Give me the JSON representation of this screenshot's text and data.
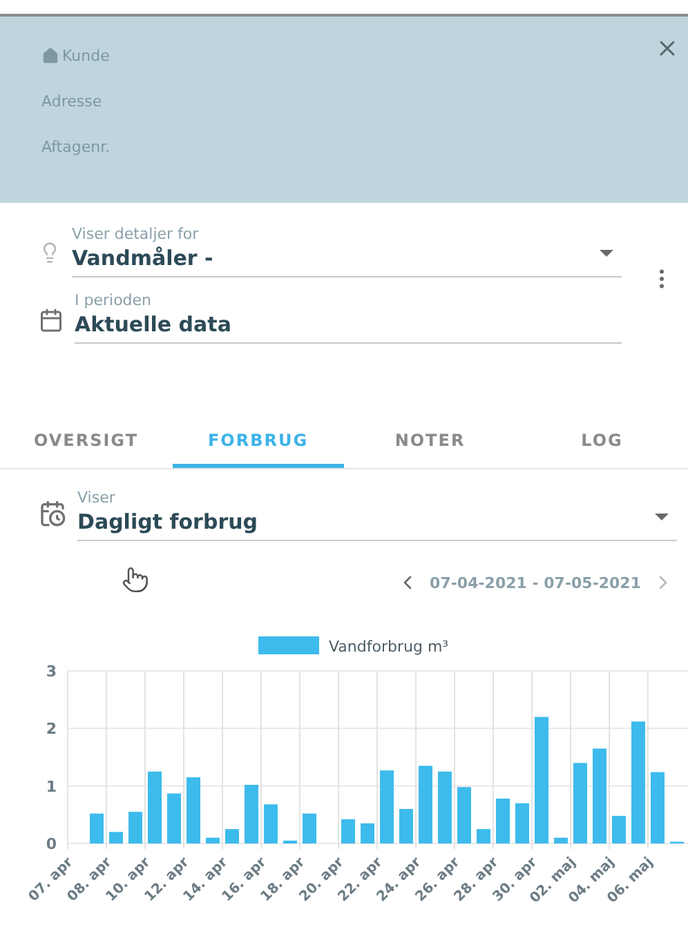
{
  "header": {
    "customer": "Kunde",
    "address": "Adresse",
    "account": "Aftagenr."
  },
  "meter_field": {
    "label": "Viser detaljer for",
    "value": "Vandmåler -"
  },
  "period_field": {
    "label": "I perioden",
    "value": "Aktuelle data"
  },
  "tabs": [
    {
      "label": "OVERSIGT",
      "selected": false
    },
    {
      "label": "FORBRUG",
      "selected": true
    },
    {
      "label": "NOTER",
      "selected": false
    },
    {
      "label": "LOG",
      "selected": false
    }
  ],
  "view_field": {
    "label": "Viser",
    "value": "Dagligt forbrug"
  },
  "date_range": "07-04-2021 - 07-05-2021",
  "chart_data": {
    "type": "bar",
    "series": [
      {
        "name": "Vandforbrug m³",
        "color": "#3dbbec",
        "values": [
          null,
          0.52,
          0.2,
          0.55,
          1.25,
          0.87,
          1.15,
          0.1,
          0.25,
          1.02,
          0.68,
          0.05,
          0.52,
          0,
          0.42,
          0.35,
          1.27,
          0.6,
          1.35,
          1.25,
          0.98,
          0.25,
          0.78,
          0.7,
          2.2,
          0.1,
          1.4,
          1.65,
          0.48,
          2.12,
          1.24,
          0.03
        ]
      }
    ],
    "categories": [
      "07. apr",
      null,
      "08. apr",
      null,
      "10. apr",
      null,
      "12. apr",
      null,
      "14. apr",
      null,
      "16. apr",
      null,
      "18. apr",
      null,
      "20. apr",
      null,
      "22. apr",
      null,
      "24. apr",
      null,
      "26. apr",
      null,
      "28. apr",
      null,
      "30. apr",
      null,
      "02. maj",
      null,
      "04. maj",
      null,
      "06. maj",
      null
    ],
    "ylim": [
      0,
      3
    ],
    "yticks": [
      0,
      1,
      2,
      3
    ],
    "grid": true
  }
}
